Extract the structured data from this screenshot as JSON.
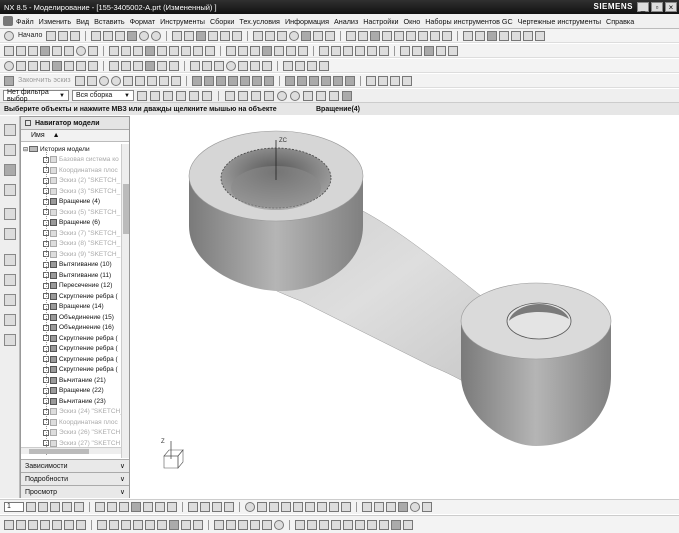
{
  "window": {
    "title": "NX 8.5 - Моделирование - [155-3405002-A.prt (Измененный) ]",
    "brand": "SIEMENS",
    "minimize": "_",
    "restore": "▫",
    "close": "×"
  },
  "menu": {
    "items": [
      "Файл",
      "Изменить",
      "Вид",
      "Вставить",
      "Формат",
      "Инструменты",
      "Сборки",
      "Тех.условия",
      "Информация",
      "Анализ",
      "Настройки",
      "Окно",
      "Наборы инструментов GC",
      "Чертежные инструменты",
      "Справка"
    ]
  },
  "toolbar": {
    "start_label": "Начало",
    "sketch_finish_label": "Закончить эскиз",
    "filter_dropdown": "Нет фильтра выбор",
    "assembly_dropdown": "Вся сборка"
  },
  "status": {
    "prompt": "Выберите объекты и нажмите МВЗ или дважды щелкните мышью на объекте",
    "feature": "Вращение(4)"
  },
  "navigator": {
    "title": "Навигатор модели",
    "column_name": "Имя",
    "root": "История модели",
    "items": [
      {
        "label": "Базовая система ко",
        "dim": true
      },
      {
        "label": "Координатная плос",
        "dim": true
      },
      {
        "label": "Эскиз (2) \"SKETCH_",
        "dim": true
      },
      {
        "label": "Эскиз (3) \"SKETCH_",
        "dim": true
      },
      {
        "label": "Вращение (4)",
        "dim": false
      },
      {
        "label": "Эскиз (5) \"SKETCH_",
        "dim": true
      },
      {
        "label": "Вращение (6)",
        "dim": false
      },
      {
        "label": "Эскиз (7) \"SKETCH_",
        "dim": true
      },
      {
        "label": "Эскиз (8) \"SKETCH_",
        "dim": true
      },
      {
        "label": "Эскиз (9) \"SKETCH_",
        "dim": true
      },
      {
        "label": "Вытягивание (10)",
        "dim": false
      },
      {
        "label": "Вытягивание (11)",
        "dim": false
      },
      {
        "label": "Пересечение (12)",
        "dim": false
      },
      {
        "label": "Скругление ребра (",
        "dim": false
      },
      {
        "label": "Вращение (14)",
        "dim": false
      },
      {
        "label": "Объединение (15)",
        "dim": false
      },
      {
        "label": "Объединение (16)",
        "dim": false
      },
      {
        "label": "Скругление ребра (",
        "dim": false
      },
      {
        "label": "Скругление ребра (",
        "dim": false
      },
      {
        "label": "Скругление ребра (",
        "dim": false
      },
      {
        "label": "Скругление ребра (",
        "dim": false
      },
      {
        "label": "Вычитание (21)",
        "dim": false
      },
      {
        "label": "Вращение (22)",
        "dim": false
      },
      {
        "label": "Вычитание (23)",
        "dim": false
      },
      {
        "label": "Эскиз (24) \"SKETCH_",
        "dim": true
      },
      {
        "label": "Координатная плос",
        "dim": true
      },
      {
        "label": "Эскиз (26) \"SKETCH",
        "dim": true
      },
      {
        "label": "Эскиз (27) \"SKETCH",
        "dim": true
      }
    ],
    "panels": [
      "Зависимости",
      "Подробности",
      "Просмотр"
    ]
  },
  "viewport": {
    "axis_label": "ZC",
    "triad_z": "Z"
  },
  "bottom": {
    "layer_value": "1"
  },
  "colors": {
    "titlebar": "#1a1a1a",
    "part_shade": "#8c8c8c"
  }
}
